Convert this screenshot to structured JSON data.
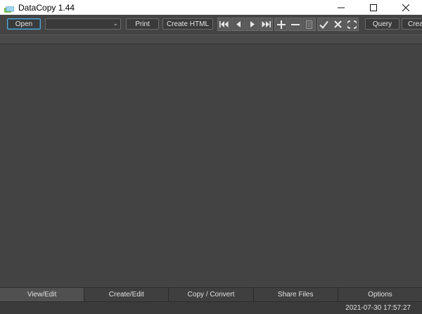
{
  "window": {
    "title": "DataCopy 1.44",
    "minimize_icon": "minimize-icon",
    "maximize_icon": "maximize-icon",
    "close_icon": "close-icon"
  },
  "toolbar": {
    "open_label": "Open",
    "combo_value": "",
    "print_label": "Print",
    "create_html_label": "Create HTML",
    "nav_buttons": [
      "first-record-icon",
      "previous-record-icon",
      "next-record-icon",
      "last-record-icon",
      "add-record-icon",
      "remove-record-icon",
      "edit-record-icon",
      "confirm-icon",
      "cancel-icon",
      "refresh-icon"
    ],
    "query_label": "Query",
    "create_label": "Crea"
  },
  "tabs": [
    {
      "label": "View/Edit"
    },
    {
      "label": "Create/Edit"
    },
    {
      "label": "Copy / Convert"
    },
    {
      "label": "Share Files"
    },
    {
      "label": "Options"
    }
  ],
  "status": {
    "timestamp": "2021-07-30 17:57:27"
  },
  "colors": {
    "background": "#434343",
    "button": "#3a3a3a",
    "focus_border": "#5fa8d3"
  }
}
